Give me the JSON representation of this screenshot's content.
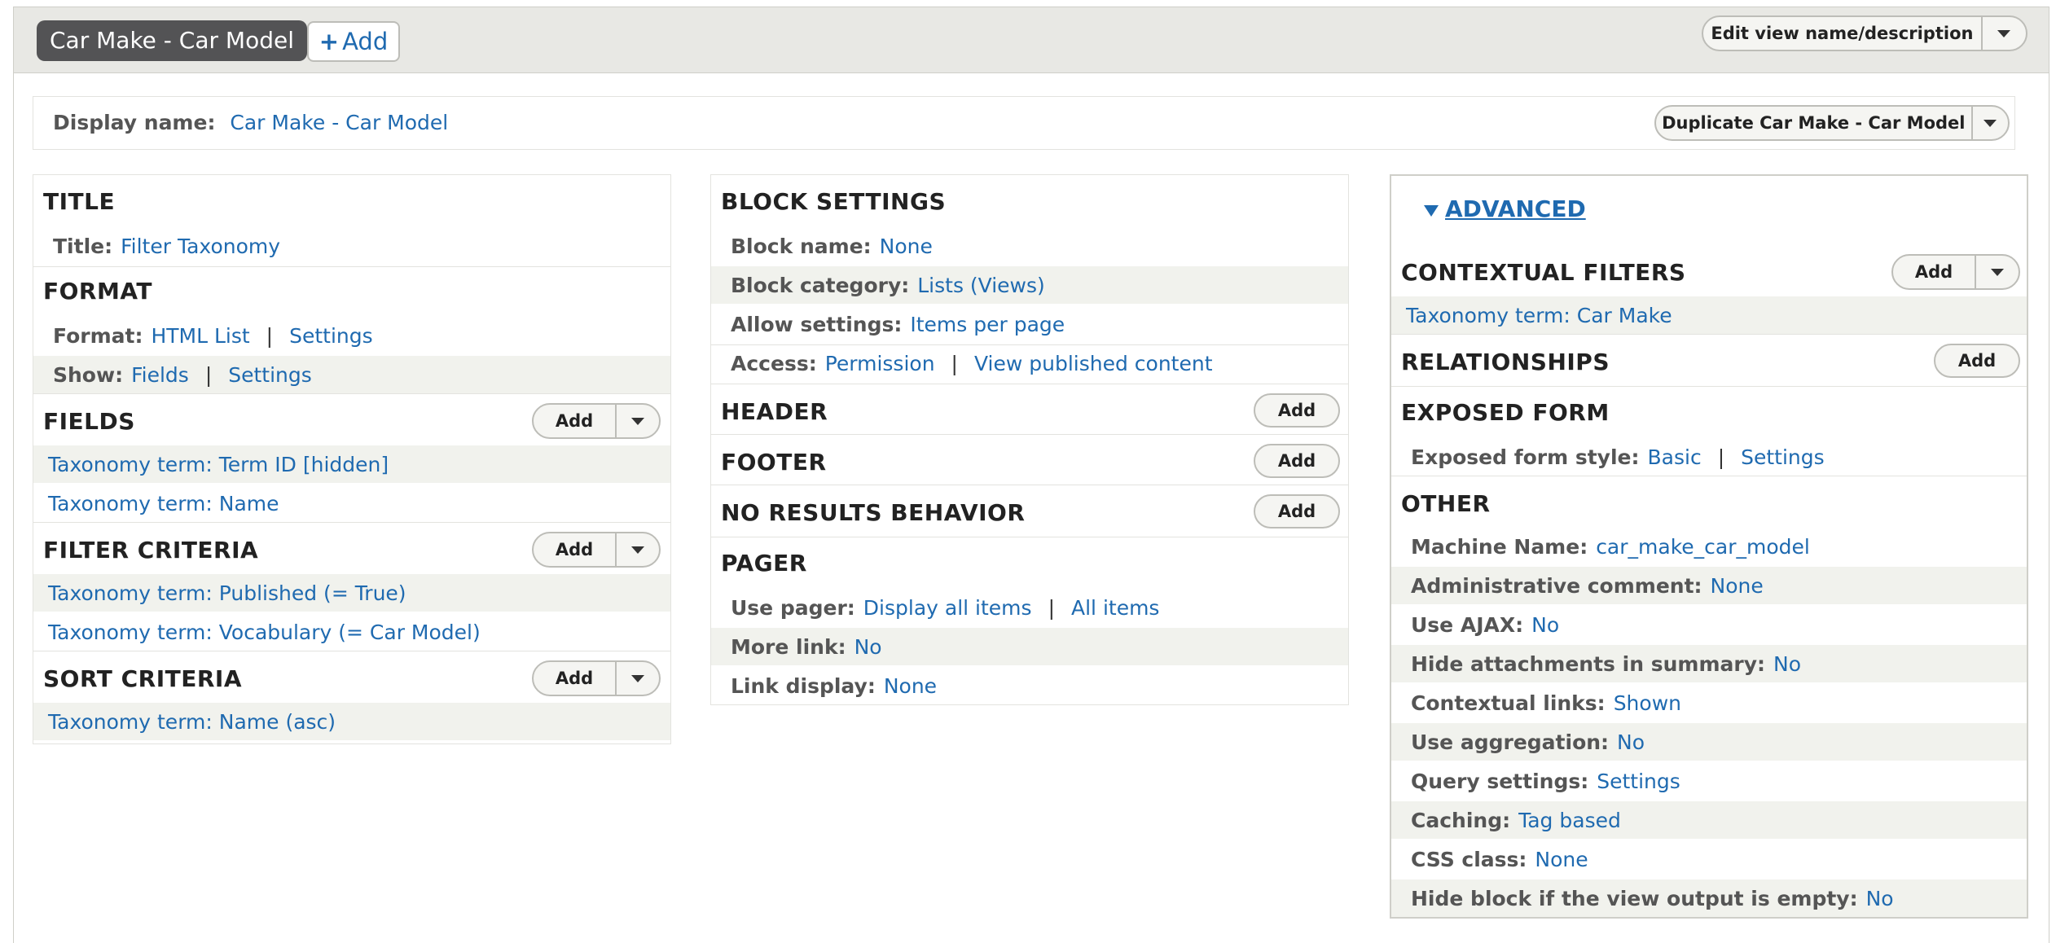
{
  "header": {
    "view_tab": "Car Make - Car Model",
    "add_label": "Add",
    "edit_label": "Edit view name/description"
  },
  "display": {
    "name_label": "Display name:",
    "name_value": "Car Make - Car Model",
    "duplicate_label": "Duplicate Car Make - Car Model"
  },
  "col1": {
    "title_heading": "TITLE",
    "title_label": "Title:",
    "title_value": "Filter Taxonomy",
    "format_heading": "FORMAT",
    "format_label": "Format:",
    "format_value": "HTML List",
    "format_settings": "Settings",
    "show_label": "Show:",
    "show_value": "Fields",
    "show_settings": "Settings",
    "fields_heading": "FIELDS",
    "fields": [
      "Taxonomy term: Term ID [hidden]",
      "Taxonomy term: Name"
    ],
    "filter_heading": "FILTER CRITERIA",
    "filters": [
      "Taxonomy term: Published (= True)",
      "Taxonomy term: Vocabulary (= Car Model)"
    ],
    "sort_heading": "SORT CRITERIA",
    "sorts": [
      "Taxonomy term: Name (asc)"
    ],
    "add_label": "Add"
  },
  "col2": {
    "block_heading": "BLOCK SETTINGS",
    "block_name_label": "Block name:",
    "block_name_value": "None",
    "block_category_label": "Block category:",
    "block_category_value": "Lists (Views)",
    "allow_label": "Allow settings:",
    "allow_value": "Items per page",
    "access_label": "Access:",
    "access_value": "Permission",
    "access_value2": "View published content",
    "header_heading": "HEADER",
    "footer_heading": "FOOTER",
    "noresults_heading": "NO RESULTS BEHAVIOR",
    "pager_heading": "PAGER",
    "pager_label": "Use pager:",
    "pager_value": "Display all items",
    "pager_value2": "All items",
    "more_label": "More link:",
    "more_value": "No",
    "linkdisplay_label": "Link display:",
    "linkdisplay_value": "None",
    "add_label": "Add"
  },
  "col3": {
    "advanced": "ADVANCED",
    "contextual_heading": "CONTEXTUAL FILTERS",
    "contextual_item": "Taxonomy term: Car Make",
    "relationships_heading": "RELATIONSHIPS",
    "exposed_heading": "EXPOSED FORM",
    "exposed_label": "Exposed form style:",
    "exposed_value": "Basic",
    "exposed_settings": "Settings",
    "other_heading": "OTHER",
    "add_label": "Add",
    "other": [
      {
        "label": "Machine Name:",
        "value": "car_make_car_model"
      },
      {
        "label": "Administrative comment:",
        "value": "None"
      },
      {
        "label": "Use AJAX:",
        "value": "No"
      },
      {
        "label": "Hide attachments in summary:",
        "value": "No"
      },
      {
        "label": "Contextual links:",
        "value": "Shown"
      },
      {
        "label": "Use aggregation:",
        "value": "No"
      },
      {
        "label": "Query settings:",
        "value": "Settings"
      },
      {
        "label": "Caching:",
        "value": "Tag based"
      },
      {
        "label": "CSS class:",
        "value": "None"
      },
      {
        "label": "Hide block if the view output is empty:",
        "value": "No"
      }
    ]
  }
}
